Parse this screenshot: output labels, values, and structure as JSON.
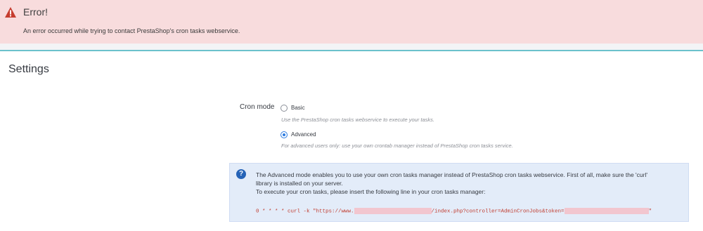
{
  "error": {
    "icon": "warning-triangle-icon",
    "title": "Error!",
    "message": "An error occurred while trying to contact PrestaShop's cron tasks webservice."
  },
  "settings": {
    "title": "Settings",
    "cron_mode_label": "Cron mode",
    "options": [
      {
        "label": "Basic",
        "help": "Use the PrestaShop cron tasks webservice to execute your tasks.",
        "checked": false
      },
      {
        "label": "Advanced",
        "help": "For advanced users only: use your own crontab manager instead of PrestaShop cron tasks service.",
        "checked": true
      }
    ]
  },
  "info": {
    "icon": "question-circle-icon",
    "line1": "The Advanced mode enables you to use your own cron tasks manager instead of PrestaShop cron tasks webservice. First of all, make sure the 'curl'",
    "line2": "library is installed on your server.",
    "line3": "To execute your cron tasks, please insert the following line in your cron tasks manager:",
    "command_prefix": "0 * * * * curl -k \"https://www.",
    "command_middle": "/index.php?controller=AdminCronJobs&token=",
    "command_suffix": "\""
  },
  "colors": {
    "error_bg": "#f8dcdd",
    "accent_border": "#6bc2cc",
    "info_bg": "#e3ecf9",
    "code_red": "#c0392b",
    "radio_blue": "#2c7be0"
  }
}
